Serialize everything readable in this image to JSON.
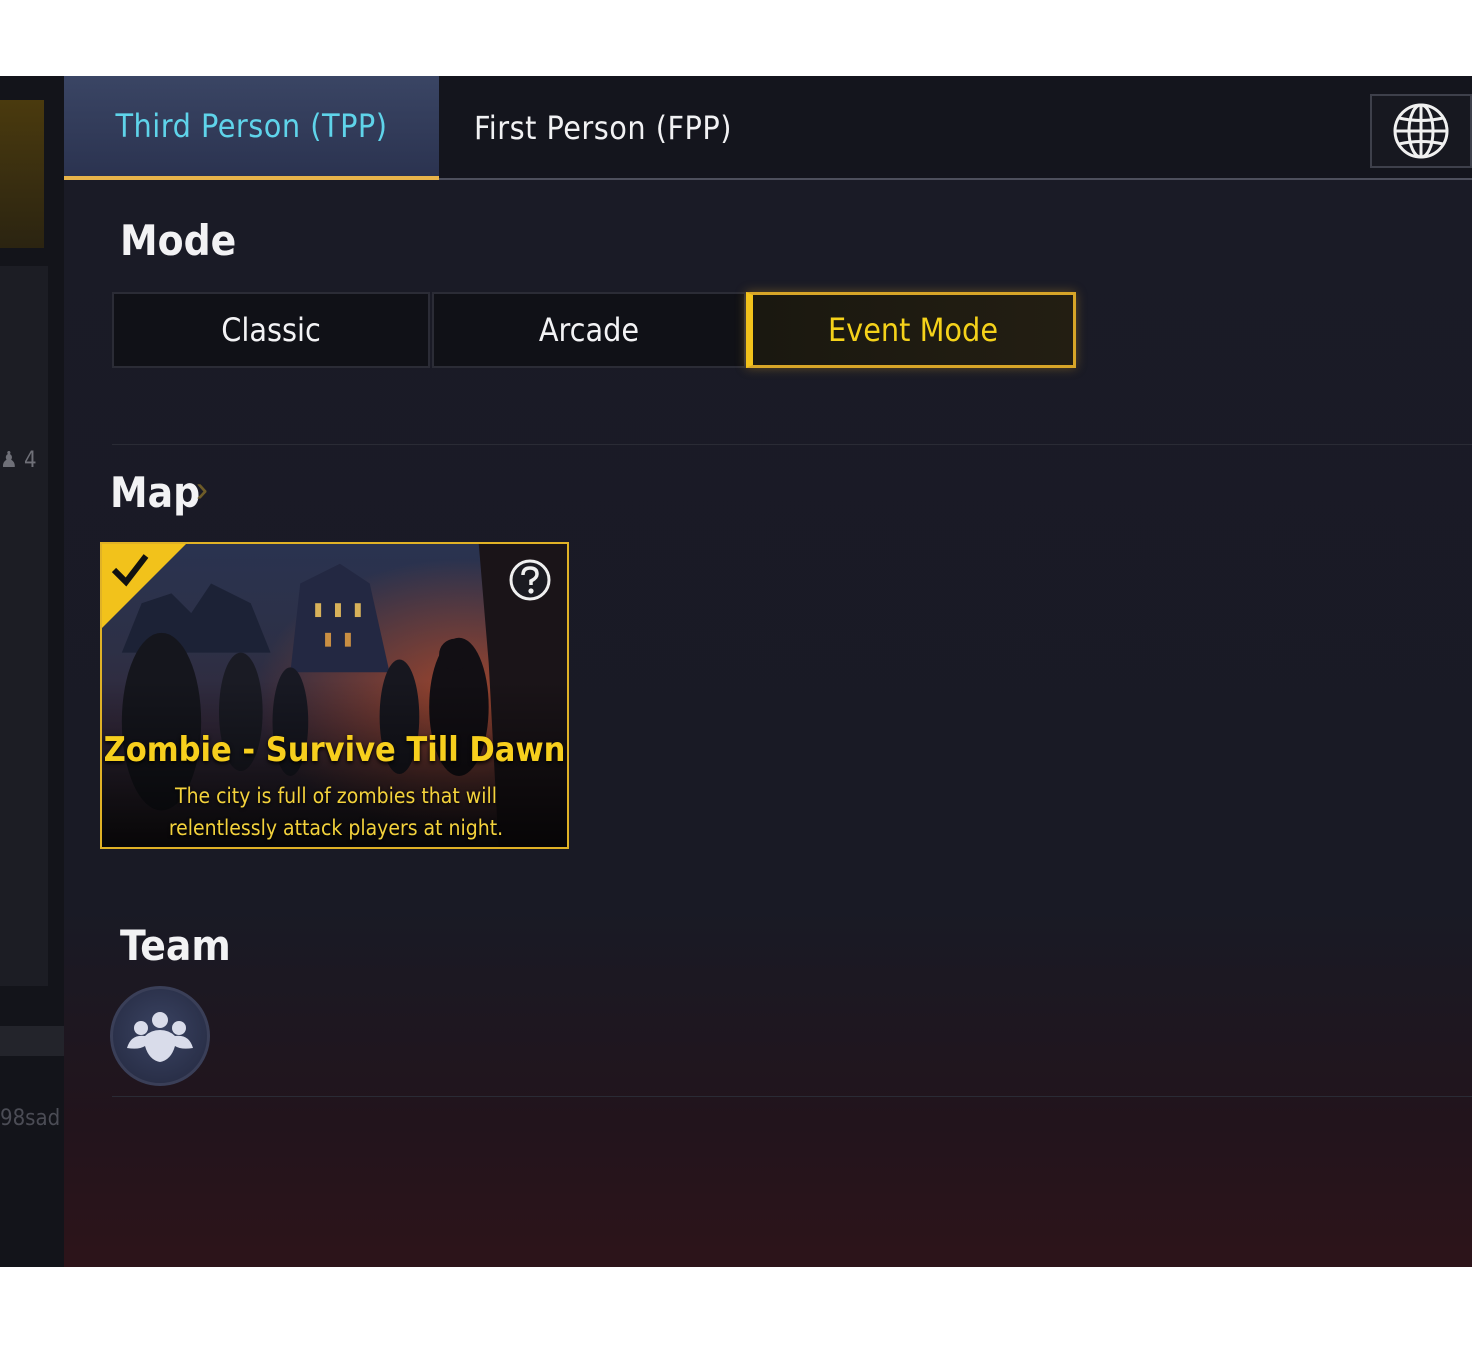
{
  "tabs": {
    "tpp_label": "Third Person (TPP)",
    "fpp_label": "First Person (FPP)"
  },
  "side": {
    "count": "4",
    "name": "98sad"
  },
  "mode": {
    "title": "Mode",
    "options": [
      "Classic",
      "Arcade",
      "Event Mode"
    ],
    "selected": "Event Mode"
  },
  "map": {
    "title": "Map",
    "card_title": "Zombie - Survive Till Dawn",
    "card_desc": "The city is full of zombies that will relentlessly attack players at night.",
    "selected": true
  },
  "team": {
    "title": "Team"
  },
  "colors": {
    "accent_gold": "#f2c21b",
    "tab_active_text": "#5fd4ea",
    "background": "#1a1b26"
  }
}
